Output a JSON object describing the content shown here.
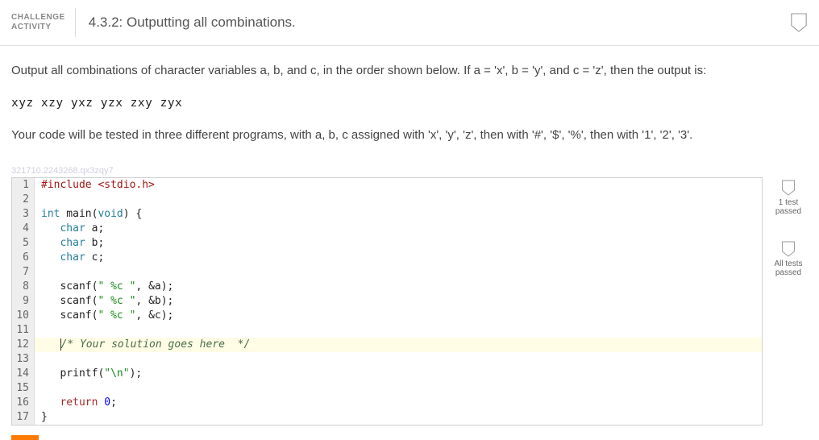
{
  "header": {
    "challenge_label_line1": "CHALLENGE",
    "challenge_label_line2": "ACTIVITY",
    "title": "4.3.2: Outputting all combinations."
  },
  "problem": {
    "intro": "Output all combinations of character variables a, b, and c, in the order shown below. If a = 'x', b = 'y', and c = 'z', then the output is:",
    "sample_output": "xyz xzy yxz yzx zxy zyx",
    "note": "Your code will be tested in three different programs, with a, b, c assigned with 'x', 'y', 'z', then with '#', '$', '%', then with '1', '2', '3'."
  },
  "watermark": "321710.2243268.qx3zqy7",
  "code": {
    "l1_pre": "#include <stdio.h>",
    "l3_type": "int",
    "l3_rest": " main(",
    "l3_arg": "void",
    "l3_end": ") {",
    "l4_type": "char",
    "l4_rest": " a;",
    "l5_type": "char",
    "l5_rest": " b;",
    "l6_type": "char",
    "l6_rest": " c;",
    "l8_fn": "scanf",
    "l8_str": "\" %c \"",
    "l8_rest": ", &a);",
    "l9_fn": "scanf",
    "l9_str": "\" %c \"",
    "l9_rest": ", &b);",
    "l10_fn": "scanf",
    "l10_str": "\" %c \"",
    "l10_rest": ", &c);",
    "l12_comment": "/* Your solution goes here  */",
    "l14_fn": "printf",
    "l14_str": "\"\\n\"",
    "l14_rest": ");",
    "l16_kw": "return",
    "l16_num": "0",
    "l16_end": ";",
    "l17": "}"
  },
  "tests": {
    "one_passed": "1 test passed",
    "all_passed": "All tests passed"
  }
}
